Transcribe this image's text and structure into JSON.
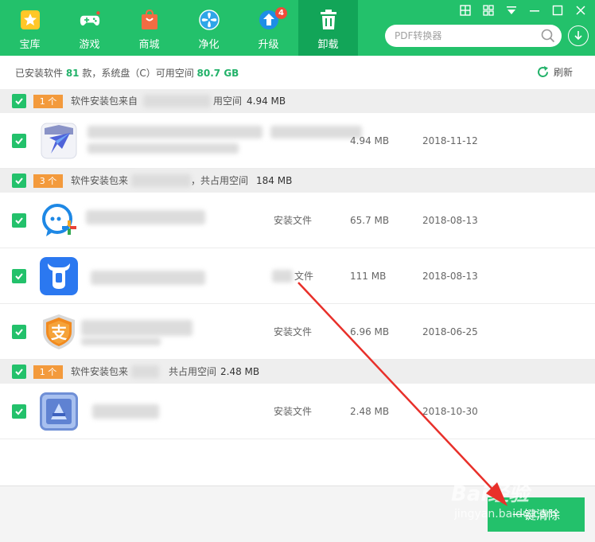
{
  "nav": {
    "items": [
      {
        "label": "宝库",
        "icon": "star-icon"
      },
      {
        "label": "游戏",
        "icon": "gamepad-icon"
      },
      {
        "label": "商城",
        "icon": "shopping-bag-icon"
      },
      {
        "label": "净化",
        "icon": "fan-icon"
      },
      {
        "label": "升级",
        "icon": "upgrade-arrow-icon",
        "badge": "4"
      },
      {
        "label": "卸载",
        "icon": "trash-icon",
        "active": true
      }
    ]
  },
  "search": {
    "placeholder": "PDF转换器"
  },
  "info": {
    "prefix": "已安装软件 ",
    "installed_count": "81",
    "middle": " 款，系统盘（C）可用空间 ",
    "free_space": "80.7 GB",
    "refresh_label": "刷新"
  },
  "groups": [
    {
      "count": "1 个",
      "text": "软件安装包来自",
      "tail": "用空间",
      "size": "4.94 MB",
      "rows": [
        {
          "type": "",
          "size": "4.94 MB",
          "date": "2018-11-12",
          "icon": "kite-app-icon"
        }
      ]
    },
    {
      "count": "3 个",
      "text": "软件安装包来",
      "tail": "，共占用空间",
      "size": "184 MB",
      "rows": [
        {
          "type": "安装文件",
          "size": "65.7 MB",
          "date": "2018-08-13",
          "icon": "chat-app-icon"
        },
        {
          "type": "文件",
          "size": "111 MB",
          "date": "2018-08-13",
          "icon": "bull-app-icon"
        },
        {
          "type": "安装文件",
          "size": "6.96 MB",
          "date": "2018-06-25",
          "icon": "alipay-shield-icon"
        }
      ]
    },
    {
      "count": "1 个",
      "text": "软件安装包来",
      "tail": "共占用空间",
      "size": "2.48 MB",
      "rows": [
        {
          "type": "安装文件",
          "size": "2.48 MB",
          "date": "2018-10-30",
          "icon": "blue-tile-app-icon"
        }
      ]
    }
  ],
  "footer": {
    "clean_label": "一键清除"
  },
  "watermark": {
    "main": "Bai经验",
    "sub": "jingyan.baidu.com"
  },
  "colors": {
    "brand": "#23c16b",
    "active_tab": "#12a558",
    "badge": "#f39a3c",
    "arrow": "#e8302a"
  }
}
